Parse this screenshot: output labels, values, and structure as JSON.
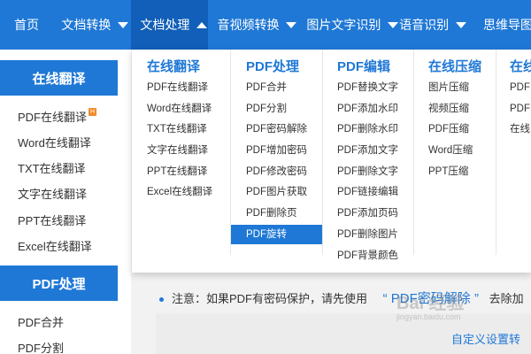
{
  "nav": {
    "items": [
      {
        "label": "首页",
        "dropdown": false
      },
      {
        "label": "文档转换",
        "dropdown": true
      },
      {
        "label": "文档处理",
        "dropdown": true,
        "active": true
      },
      {
        "label": "音视频转换",
        "dropdown": true
      },
      {
        "label": "图片文字识别",
        "dropdown": true
      },
      {
        "label": "语音识别",
        "dropdown": true
      },
      {
        "label": "思维导图",
        "dropdown": false
      }
    ]
  },
  "sidebar": {
    "section1_title": "在线翻译",
    "section1_items": [
      "PDF在线翻译",
      "Word在线翻译",
      "TXT在线翻译",
      "文字在线翻译",
      "PPT在线翻译",
      "Excel在线翻译"
    ],
    "hot_badge": "H",
    "section2_title": "PDF处理",
    "section2_items": [
      "PDF合并",
      "PDF分割"
    ]
  },
  "dropdown": {
    "columns": [
      {
        "title": "在线翻译",
        "items": [
          "PDF在线翻译",
          "Word在线翻译",
          "TXT在线翻译",
          "文字在线翻译",
          "PPT在线翻译",
          "Excel在线翻译"
        ]
      },
      {
        "title": "PDF处理",
        "items": [
          "PDF合并",
          "PDF分割",
          "PDF密码解除",
          "PDF增加密码",
          "PDF修改密码",
          "PDF图片获取",
          "PDF删除页",
          "PDF旋转"
        ],
        "selected": "PDF旋转"
      },
      {
        "title": "PDF编辑",
        "items": [
          "PDF替换文字",
          "PDF添加水印",
          "PDF删除水印",
          "PDF添加文字",
          "PDF删除文字",
          "PDF链接编辑",
          "PDF添加页码",
          "PDF删除图片",
          "PDF背景颜色"
        ]
      },
      {
        "title": "在线压缩",
        "items": [
          "图片压缩",
          "视频压缩",
          "PDF压缩",
          "Word压缩",
          "PPT压缩"
        ]
      },
      {
        "title": "在线",
        "items": [
          "PDF",
          "PDF",
          "在线"
        ]
      }
    ]
  },
  "notice": {
    "text": "注意：如果PDF有密码保护，请先使用",
    "link": "“ PDF密码解除 ”",
    "suffix": "去除加"
  },
  "custom_settings": "自定义设置转",
  "watermark": {
    "text": "Bai 经验",
    "sub": "jingyan.baidu.com"
  },
  "colors": {
    "nav_bg": "#1f78d6",
    "nav_active": "#115fb8",
    "accent": "#1f78d6"
  }
}
